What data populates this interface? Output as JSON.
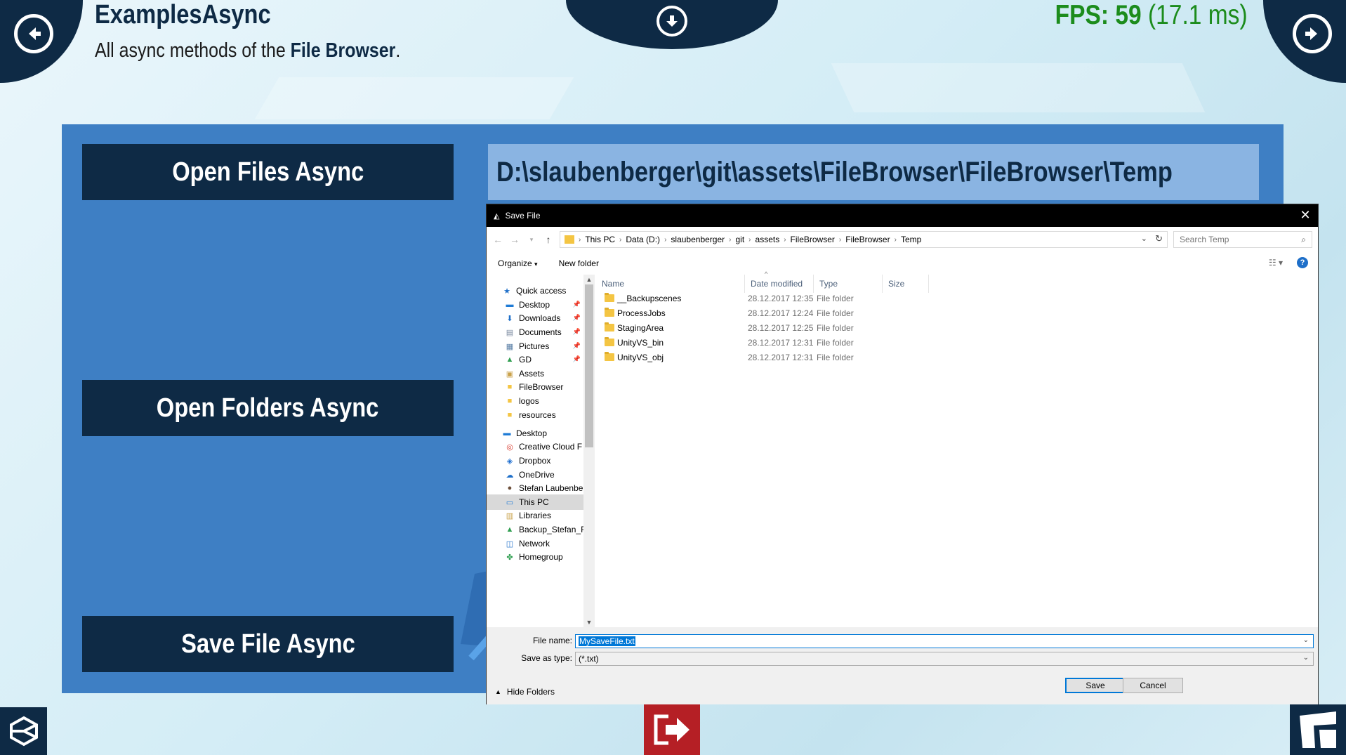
{
  "header": {
    "title": "ExamplesAsync",
    "subtitle_prefix": "All async methods of the ",
    "subtitle_bold": "File Browser",
    "subtitle_suffix": ".",
    "fps_label": "FPS: 59",
    "fps_ms": "(17.1 ms)"
  },
  "actions": {
    "open_files": "Open Files Async",
    "open_folders": "Open Folders Async",
    "save_file": "Save File Async"
  },
  "path_display": "D:\\slaubenberger\\git\\assets\\FileBrowser\\FileBrowser\\Temp",
  "dialog": {
    "title": "Save File",
    "breadcrumbs": [
      "This PC",
      "Data (D:)",
      "slaubenberger",
      "git",
      "assets",
      "FileBrowser",
      "FileBrowser",
      "Temp"
    ],
    "search_placeholder": "Search Temp",
    "toolbar": {
      "organize": "Organize",
      "new_folder": "New folder"
    },
    "nav": [
      {
        "label": "Quick access",
        "icon": "star-icon",
        "indent": 0,
        "pinned": false
      },
      {
        "label": "Desktop",
        "icon": "desktop-icon",
        "indent": 1,
        "pinned": true
      },
      {
        "label": "Downloads",
        "icon": "download-icon",
        "indent": 1,
        "pinned": true
      },
      {
        "label": "Documents",
        "icon": "document-icon",
        "indent": 1,
        "pinned": true
      },
      {
        "label": "Pictures",
        "icon": "picture-icon",
        "indent": 1,
        "pinned": true
      },
      {
        "label": "GD",
        "icon": "drive-icon",
        "indent": 1,
        "pinned": true
      },
      {
        "label": "Assets",
        "icon": "user-folder-icon",
        "indent": 1,
        "pinned": false
      },
      {
        "label": "FileBrowser",
        "icon": "folder-icon",
        "indent": 1,
        "pinned": false
      },
      {
        "label": "logos",
        "icon": "folder-icon",
        "indent": 1,
        "pinned": false
      },
      {
        "label": "resources",
        "icon": "folder-icon",
        "indent": 1,
        "pinned": false
      },
      {
        "label": "Desktop",
        "icon": "desktop-icon",
        "indent": 0,
        "pinned": false
      },
      {
        "label": "Creative Cloud F",
        "icon": "creative-cloud-icon",
        "indent": 1,
        "pinned": false
      },
      {
        "label": "Dropbox",
        "icon": "dropbox-icon",
        "indent": 1,
        "pinned": false
      },
      {
        "label": "OneDrive",
        "icon": "onedrive-icon",
        "indent": 1,
        "pinned": false
      },
      {
        "label": "Stefan Laubenbe",
        "icon": "user-icon",
        "indent": 1,
        "pinned": false
      },
      {
        "label": "This PC",
        "icon": "computer-icon",
        "indent": 1,
        "pinned": false,
        "selected": true
      },
      {
        "label": "Libraries",
        "icon": "library-icon",
        "indent": 1,
        "pinned": false
      },
      {
        "label": "Backup_Stefan_F",
        "icon": "drive-icon",
        "indent": 1,
        "pinned": false
      },
      {
        "label": "Network",
        "icon": "network-icon",
        "indent": 1,
        "pinned": false
      },
      {
        "label": "Homegroup",
        "icon": "homegroup-icon",
        "indent": 1,
        "pinned": false
      }
    ],
    "columns": [
      "Name",
      "Date modified",
      "Type",
      "Size"
    ],
    "files": [
      {
        "name": "__Backupscenes",
        "date": "28.12.2017 12:35",
        "type": "File folder"
      },
      {
        "name": "ProcessJobs",
        "date": "28.12.2017 12:24",
        "type": "File folder"
      },
      {
        "name": "StagingArea",
        "date": "28.12.2017 12:25",
        "type": "File folder"
      },
      {
        "name": "UnityVS_bin",
        "date": "28.12.2017 12:31",
        "type": "File folder"
      },
      {
        "name": "UnityVS_obj",
        "date": "28.12.2017 12:31",
        "type": "File folder"
      }
    ],
    "file_name_label": "File name:",
    "file_name_value": "MySaveFile.txt",
    "save_type_label": "Save as type:",
    "save_type_value": "(*.txt)",
    "hide_folders": "Hide Folders",
    "save_button": "Save",
    "cancel_button": "Cancel"
  },
  "colors": {
    "navy": "#0e2a45",
    "panel_blue": "#3e7fc4",
    "path_blue": "#8ab4e2",
    "fps_green": "#1c8c1c",
    "exit_red": "#b51f25"
  }
}
